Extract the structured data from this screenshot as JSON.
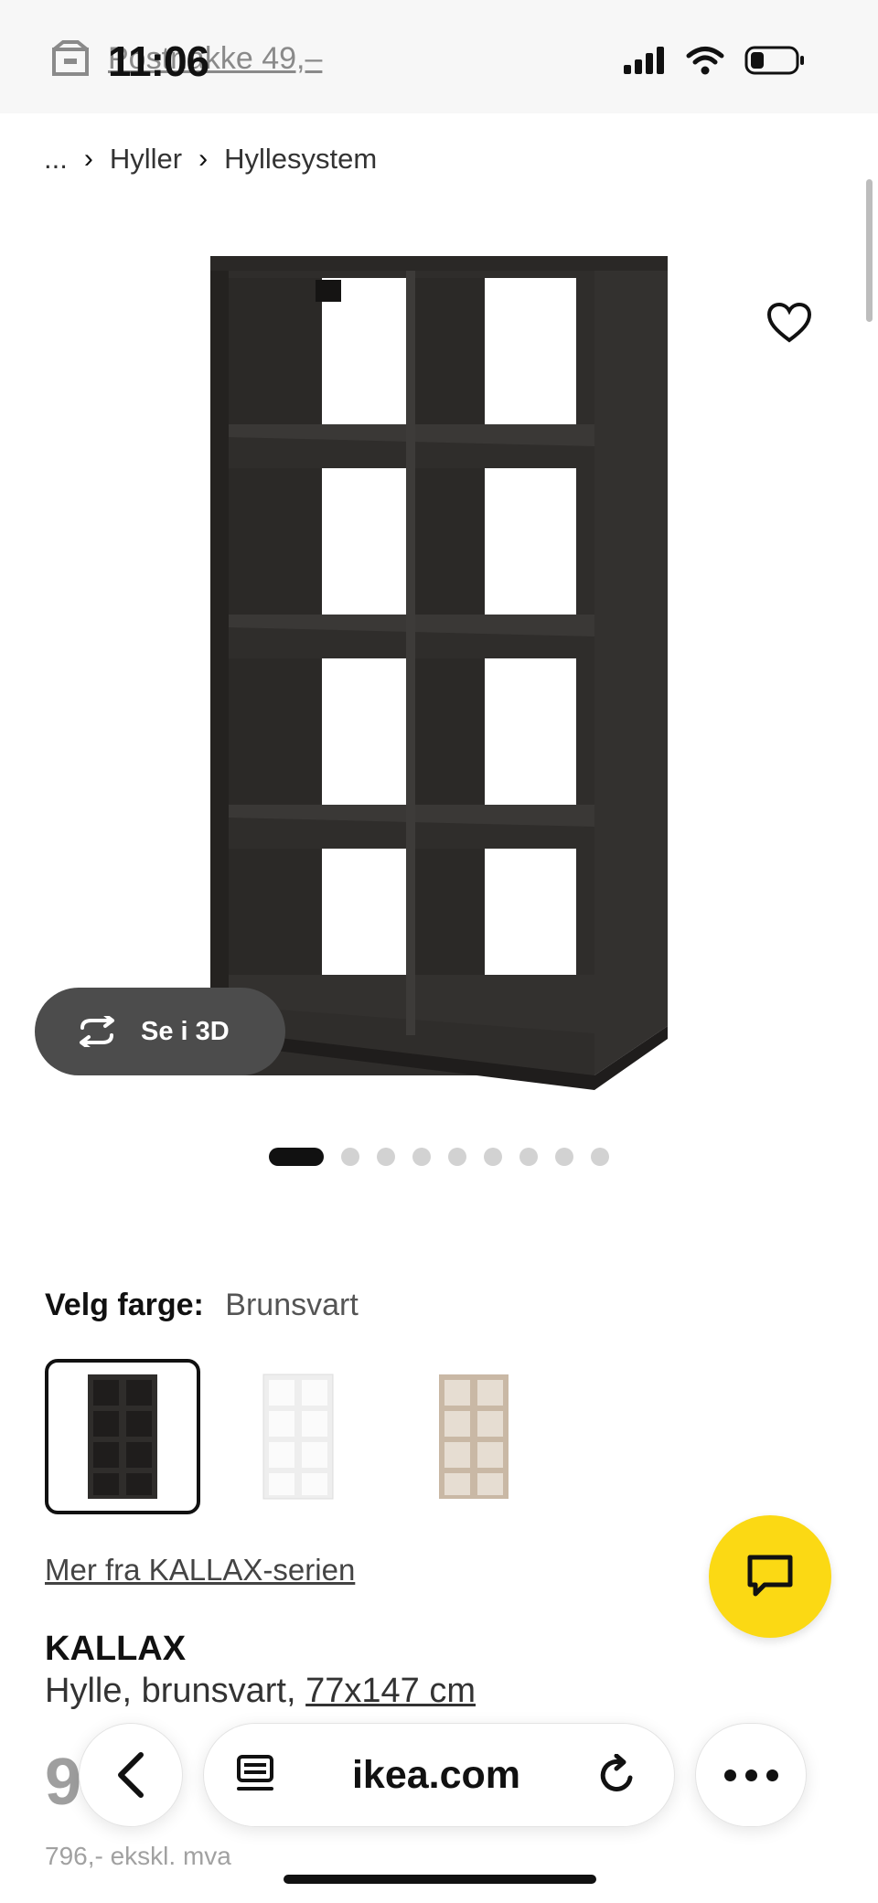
{
  "status_bar": {
    "time": "11:06",
    "postcode_text": "Postnakke 49,–"
  },
  "breadcrumb": {
    "items": [
      "...",
      "Hyller",
      "Hyllesystem"
    ],
    "separator": "›"
  },
  "gallery": {
    "see_3d_label": "Se i 3D",
    "image_count": 9,
    "active_index": 0
  },
  "color": {
    "label": "Velg farge:",
    "selected_value": "Brunsvart",
    "swatches": [
      {
        "name": "brunsvart",
        "hex": "#2f2d2b"
      },
      {
        "name": "hvit",
        "hex": "#f4f4f4"
      },
      {
        "name": "hvitbeiset eikemønstret",
        "hex": "#c9b8a5"
      }
    ]
  },
  "series_link": "Mer fra KALLAX-serien",
  "product": {
    "name": "KALLAX",
    "description": "Hylle, brunsvart,",
    "dimensions": "77x147 cm",
    "price": "9",
    "price_suffix": ",-",
    "price_ex_vat": "796,- ekskl. mva"
  },
  "browser": {
    "url": "ikea.com"
  },
  "colors": {
    "fab_yellow": "#fbd914",
    "shelf_dark": "#2f2d2b",
    "button_3d_bg": "#4c4c4c"
  }
}
